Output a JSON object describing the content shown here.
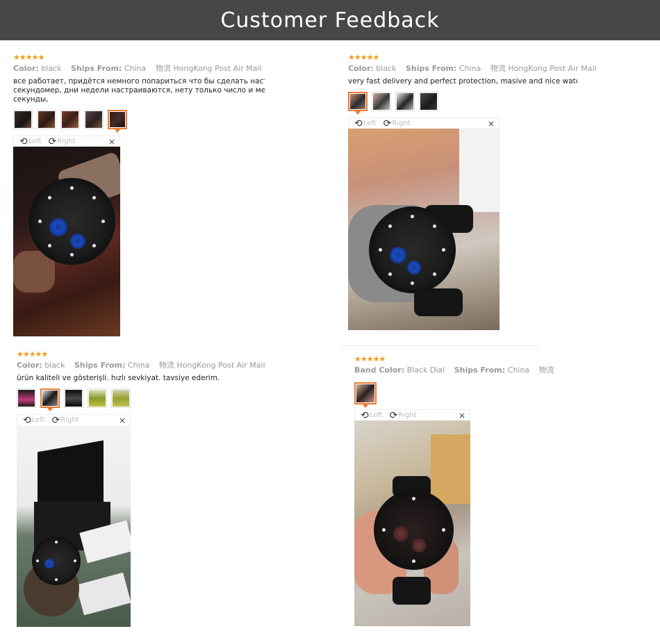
{
  "banner": {
    "title": "Customer Feedback"
  },
  "labels": {
    "color": "Color:",
    "band_color": "Band Color:",
    "ships_from": "Ships From:",
    "rotate_left": "Left",
    "rotate_right": "Right",
    "close": "×",
    "stars": "★★★★★"
  },
  "colors": {
    "banner_bg": "#474747",
    "star": "#f39c12",
    "active_thumb": "#e87b34"
  },
  "reviews": [
    {
      "color_value": "black",
      "ships_value": "China",
      "shipping": "物流 HongKong Post Air Mail",
      "comment_line1": "все работает, придётся немного попариться что бы сделать настройки, но н",
      "comment_line2": "секундомер, дни недели настраиваются, нету только число и месяц, цифров",
      "comment_line3": "секунды,"
    },
    {
      "color_value": "black",
      "ships_value": "China",
      "shipping": "物流 HongKong Post Air Mail",
      "comment_line1": "very fast delivery and perfect protection, masive and nice watch"
    },
    {
      "color_value": "black",
      "ships_value": "China",
      "shipping": "物流 HongKong Post Air Mail",
      "comment_line1": "ürün kaliteli ve gösterişli. hızlı sevkiyat. tavsiye ederim."
    },
    {
      "color_value": "Black Dial",
      "ships_value": "China",
      "shipping": "物流"
    }
  ]
}
